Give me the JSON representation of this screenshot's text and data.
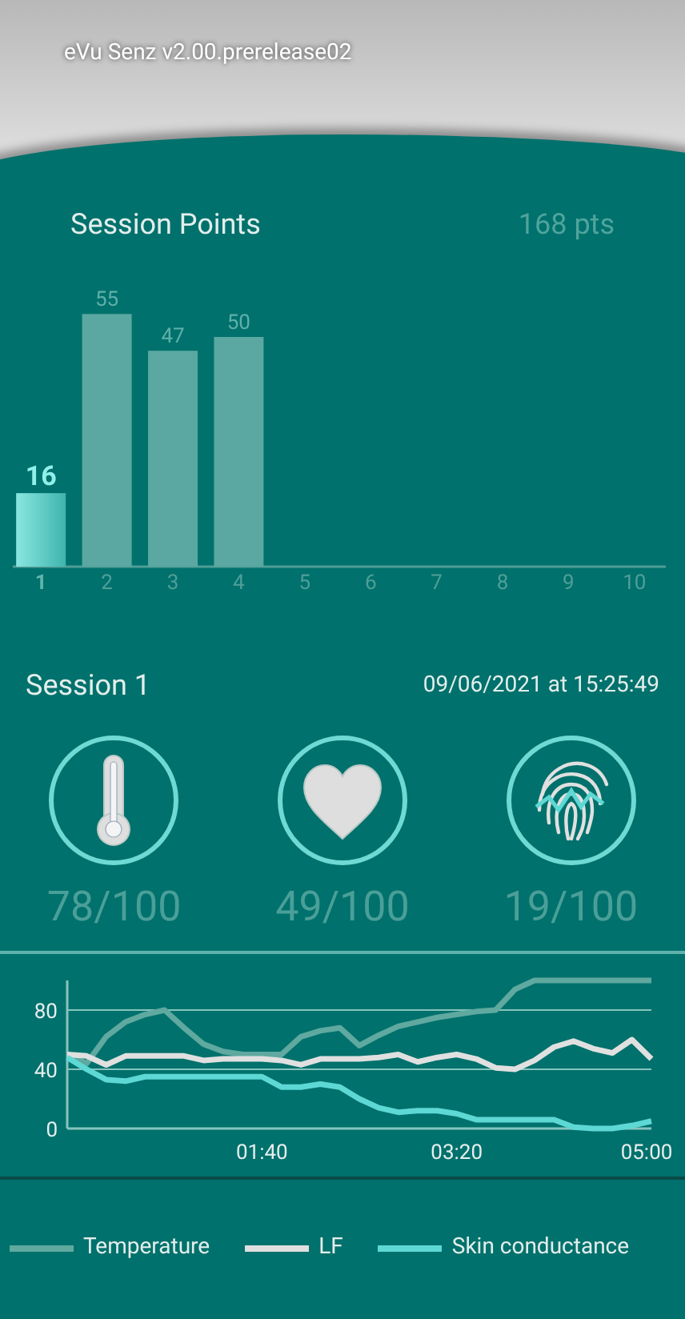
{
  "app_title": "eVu Senz v2.00.prerelease02",
  "session_points": {
    "title": "Session Points",
    "total": "168 pts",
    "bars": [
      {
        "selected": true
      },
      {
        "selected": false
      },
      {
        "selected": false
      },
      {
        "selected": false
      },
      {
        "selected": false
      },
      {
        "selected": false
      },
      {
        "selected": false
      },
      {
        "selected": false
      },
      {
        "selected": false
      },
      {
        "selected": false
      }
    ],
    "chart_data": {
      "type": "bar",
      "categories": [
        "1",
        "2",
        "3",
        "4",
        "5",
        "6",
        "7",
        "8",
        "9",
        "10"
      ],
      "values": [
        16,
        55,
        47,
        50,
        null,
        null,
        null,
        null,
        null,
        null
      ],
      "data_labels": true
    }
  },
  "session": {
    "title": "Session 1",
    "datetime": "09/06/2021 at 15:25:49",
    "metrics": [
      {
        "kind": "temperature",
        "score": "78/100"
      },
      {
        "kind": "heart",
        "score": "49/100"
      },
      {
        "kind": "fingerprint",
        "score": "19/100"
      }
    ]
  },
  "signals": {
    "chart_data": {
      "type": "line",
      "x": [
        0,
        10,
        20,
        30,
        40,
        50,
        60,
        70,
        80,
        90,
        100,
        110,
        120,
        130,
        140,
        150,
        160,
        170,
        180,
        190,
        200,
        210,
        220,
        230,
        240,
        250,
        260,
        270,
        280,
        290,
        300
      ],
      "xlim": [
        0,
        300
      ],
      "ylim": [
        0,
        100
      ],
      "yticks": [
        0,
        40,
        80
      ],
      "xticks": [
        {
          "value": 100,
          "label": "01:40"
        },
        {
          "value": 200,
          "label": "03:20"
        },
        {
          "value": 300,
          "label": "05:00"
        }
      ],
      "series": [
        {
          "name": "Temperature",
          "color": "#5fa9a0",
          "values": [
            50,
            44,
            62,
            72,
            77,
            80,
            68,
            57,
            52,
            50,
            50,
            50,
            62,
            66,
            68,
            56,
            63,
            69,
            72,
            75,
            77,
            79,
            80,
            94,
            100,
            100,
            100,
            100,
            100,
            100,
            100
          ]
        },
        {
          "name": "LF",
          "color": "#e0e0e0",
          "values": [
            50,
            49,
            43,
            49,
            49,
            49,
            49,
            46,
            47,
            47,
            47,
            46,
            43,
            47,
            47,
            47,
            48,
            50,
            45,
            48,
            50,
            47,
            41,
            40,
            46,
            55,
            59,
            54,
            51,
            60,
            47
          ]
        },
        {
          "name": "Skin conductance",
          "color": "#5ed8d4",
          "values": [
            48,
            40,
            33,
            32,
            35,
            35,
            35,
            35,
            35,
            35,
            35,
            28,
            28,
            30,
            28,
            20,
            14,
            11,
            12,
            12,
            10,
            6,
            6,
            6,
            6,
            6,
            1,
            0,
            0,
            2,
            5
          ]
        }
      ]
    }
  }
}
